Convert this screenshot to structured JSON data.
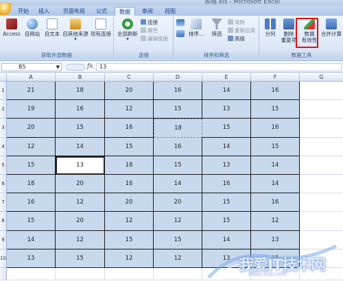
{
  "window": {
    "title": "Microsoft Excel",
    "title_partial": "表格.xls  -  Microsoft Excel"
  },
  "tabs": [
    {
      "label": "开始",
      "active": false
    },
    {
      "label": "插入",
      "active": false
    },
    {
      "label": "页面布局",
      "active": false
    },
    {
      "label": "公式",
      "active": false
    },
    {
      "label": "数据",
      "active": true
    },
    {
      "label": "审阅",
      "active": false
    },
    {
      "label": "视图",
      "active": false
    }
  ],
  "ribbon": {
    "external": {
      "label": "获取外部数据",
      "access": "Access",
      "web": "自网站",
      "text": "自文本",
      "other": "自其他来源",
      "existing": "现有连接"
    },
    "connections": {
      "label": "连接",
      "refresh_all": "全部刷新",
      "connections": "连接",
      "properties": "属性",
      "edit_links": "编辑链接"
    },
    "sort_filter": {
      "label": "排序和筛选",
      "sort": "排序...",
      "filter": "筛选",
      "clear": "清除",
      "reapply": "重新应用",
      "advanced": "高级"
    },
    "data_tools": {
      "label": "数据工具",
      "split": "分列",
      "remove_dup_1": "删除",
      "remove_dup_2": "重复项",
      "validation_1": "数据",
      "validation_2": "有效性",
      "consolidate": "合并计算"
    }
  },
  "formula_bar": {
    "name_box": "B5",
    "fx": "fx",
    "value": "13"
  },
  "columns": [
    "A",
    "B",
    "C",
    "D",
    "E",
    "F",
    "G"
  ],
  "rows": [
    {
      "n": "1",
      "cells": [
        "21",
        "18",
        "20",
        "16",
        "14",
        "16"
      ]
    },
    {
      "n": "2",
      "cells": [
        "19",
        "16",
        "12",
        "15",
        "13",
        "15"
      ]
    },
    {
      "n": "3",
      "cells": [
        "20",
        "15",
        "16",
        "18",
        "15",
        "16"
      ]
    },
    {
      "n": "4",
      "cells": [
        "12",
        "14",
        "15",
        "16",
        "14",
        "15"
      ]
    },
    {
      "n": "5",
      "cells": [
        "15",
        "13",
        "18",
        "15",
        "13",
        "14"
      ]
    },
    {
      "n": "6",
      "cells": [
        "18",
        "20",
        "16",
        "14",
        "16",
        "14"
      ]
    },
    {
      "n": "7",
      "cells": [
        "16",
        "12",
        "20",
        "20",
        "15",
        "16"
      ]
    },
    {
      "n": "8",
      "cells": [
        "15",
        "20",
        "12",
        "12",
        "15",
        "12"
      ]
    },
    {
      "n": "9",
      "cells": [
        "14",
        "12",
        "15",
        "15",
        "14",
        "13"
      ]
    },
    {
      "n": "10",
      "cells": [
        "13",
        "15",
        "12",
        "12",
        "13",
        "15"
      ]
    },
    {
      "n": "",
      "cells": [
        "",
        "",
        "",
        "",
        "",
        ""
      ]
    }
  ],
  "watermark": {
    "text": "我爱IT技术网",
    "url": "www.52ij.com"
  },
  "colors": {
    "selection_fill": "#c8d9ee",
    "highlight": "#e01010"
  }
}
